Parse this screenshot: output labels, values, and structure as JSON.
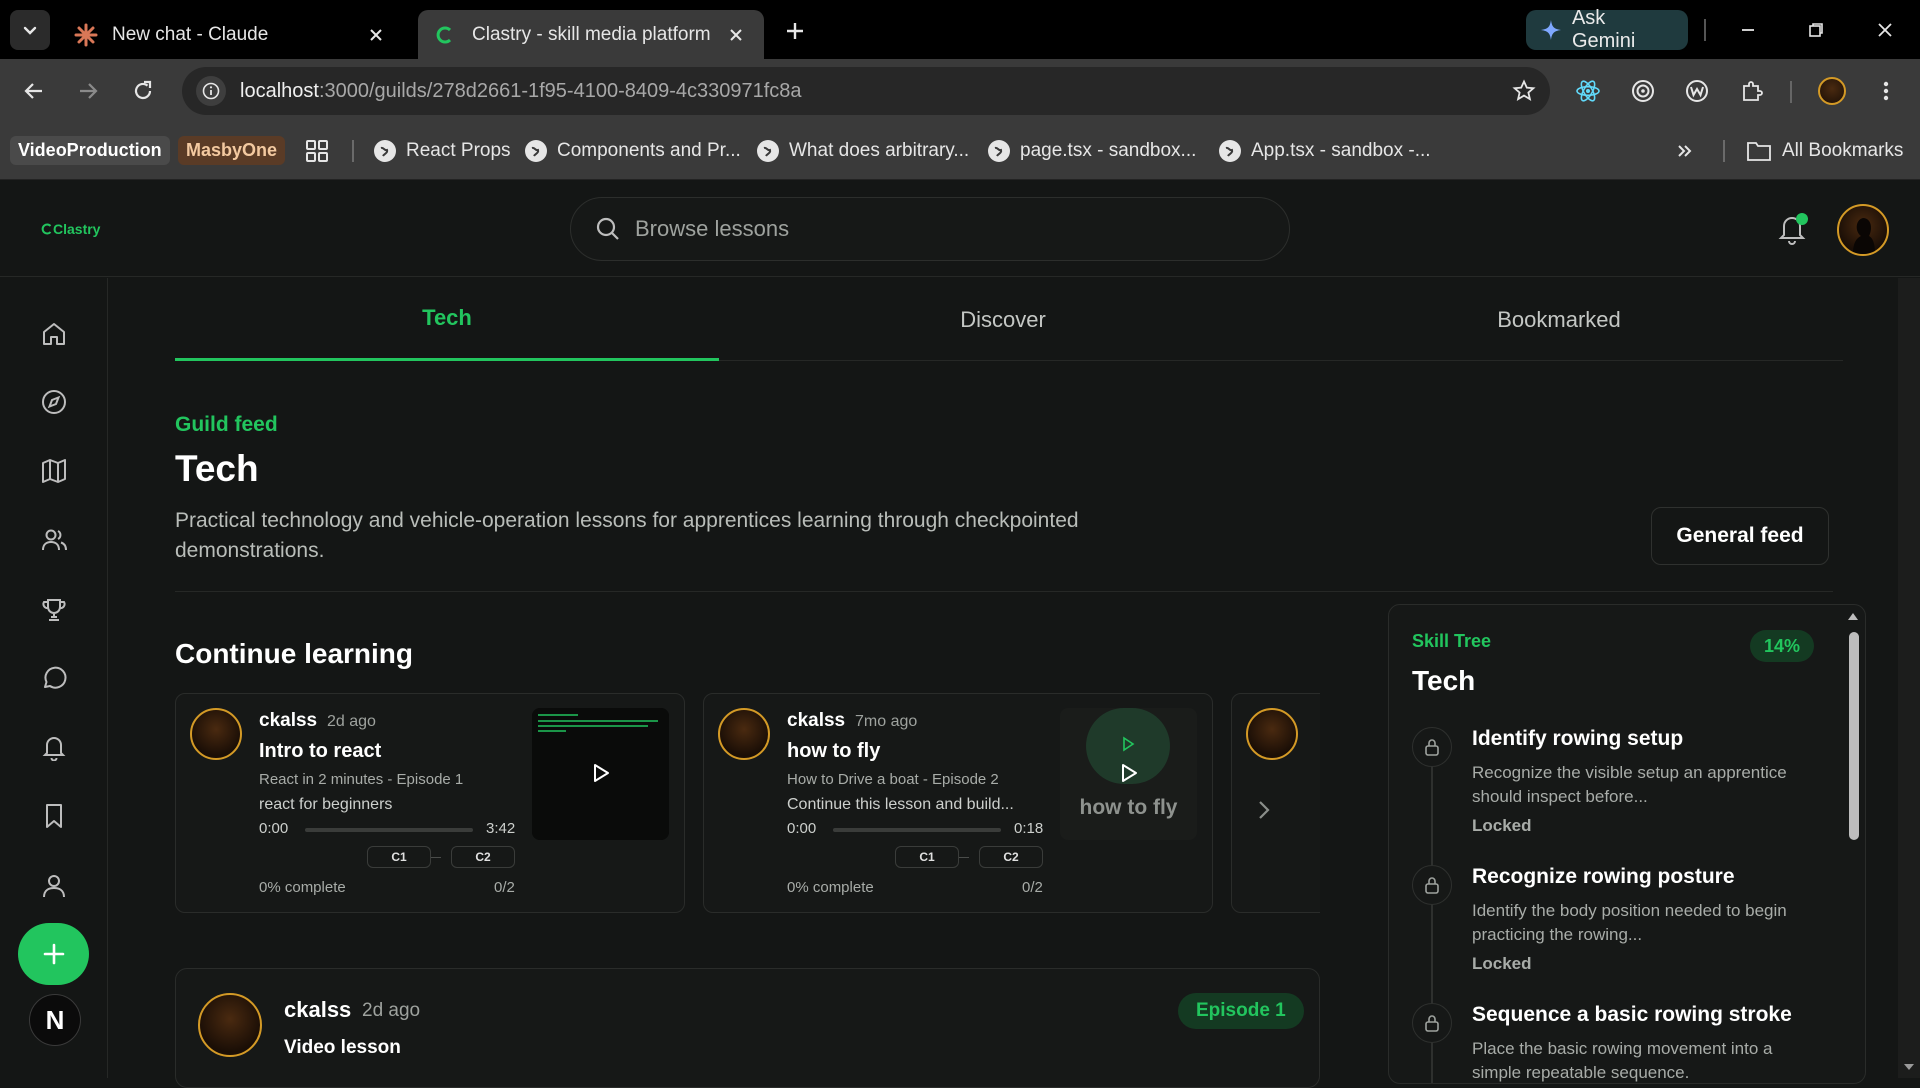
{
  "browser": {
    "tabs": [
      {
        "title": "New chat - Claude",
        "icon": "claude-logo-icon"
      },
      {
        "title": "Clastry - skill media platform",
        "icon": "clastry-favicon-icon"
      }
    ],
    "gemini_label": "Ask Gemini",
    "url_host": "localhost",
    "url_path": ":3000/guilds/278d2661-1f95-4100-8409-4c330971fc8a",
    "bookmarks": {
      "badges": [
        {
          "label": "VideoProduction",
          "bg": "#4a4a4a",
          "fg": "#ffffff"
        },
        {
          "label": "MasbyOne",
          "bg": "#5a3b26",
          "fg": "#f3c9a0"
        }
      ],
      "items": [
        "React Props",
        "Components and Pr...",
        "What does arbitrary...",
        "page.tsx - sandbox...",
        "App.tsx - sandbox -..."
      ],
      "all_label": "All Bookmarks"
    }
  },
  "app": {
    "logo": "Clastry",
    "search_placeholder": "Browse lessons",
    "accent": "#22c55e",
    "sidebar_icons": [
      "home-icon",
      "compass-icon",
      "map-icon",
      "users-icon",
      "trophy-icon",
      "chat-icon",
      "bell-icon",
      "bookmark-icon",
      "user-icon"
    ],
    "n_label": "N",
    "tabs": [
      "Tech",
      "Discover",
      "Bookmarked"
    ],
    "active_tab": "Tech",
    "eyebrow": "Guild feed",
    "title": "Tech",
    "description": "Practical technology and vehicle-operation lessons for apprentices learning through checkpointed demonstrations.",
    "general_feed_label": "General feed",
    "continue_title": "Continue learning",
    "cards": [
      {
        "user": "ckalss",
        "time": "2d ago",
        "title": "Intro to react",
        "series": "React in 2 minutes - Episode 1",
        "line": "react for beginners",
        "t_start": "0:00",
        "t_end": "3:42",
        "progress": 0,
        "checkpoints": [
          "C1",
          "C2"
        ],
        "complete_label": "0% complete",
        "count": "0/2"
      },
      {
        "user": "ckalss",
        "time": "7mo ago",
        "title": "how to fly",
        "series": "How to Drive a boat - Episode 2",
        "line": "Continue this lesson and build...",
        "t_start": "0:00",
        "t_end": "0:18",
        "progress": 0,
        "checkpoints": [
          "C1",
          "C2"
        ],
        "complete_label": "0% complete",
        "count": "0/2",
        "thumb_text": "how to fly"
      }
    ],
    "post": {
      "user": "ckalss",
      "time": "2d ago",
      "type": "Video lesson",
      "badge": "Episode 1"
    },
    "skill_tree": {
      "eyebrow": "Skill Tree",
      "title": "Tech",
      "percent": "14%",
      "items": [
        {
          "name": "Identify rowing setup",
          "desc": "Recognize the visible setup an apprentice should inspect before...",
          "status": "Locked"
        },
        {
          "name": "Recognize rowing posture",
          "desc": "Identify the body position needed to begin practicing the rowing...",
          "status": "Locked"
        },
        {
          "name": "Sequence a basic rowing stroke",
          "desc": "Place the basic rowing movement into a simple repeatable sequence.",
          "status": "Locked"
        }
      ]
    }
  }
}
